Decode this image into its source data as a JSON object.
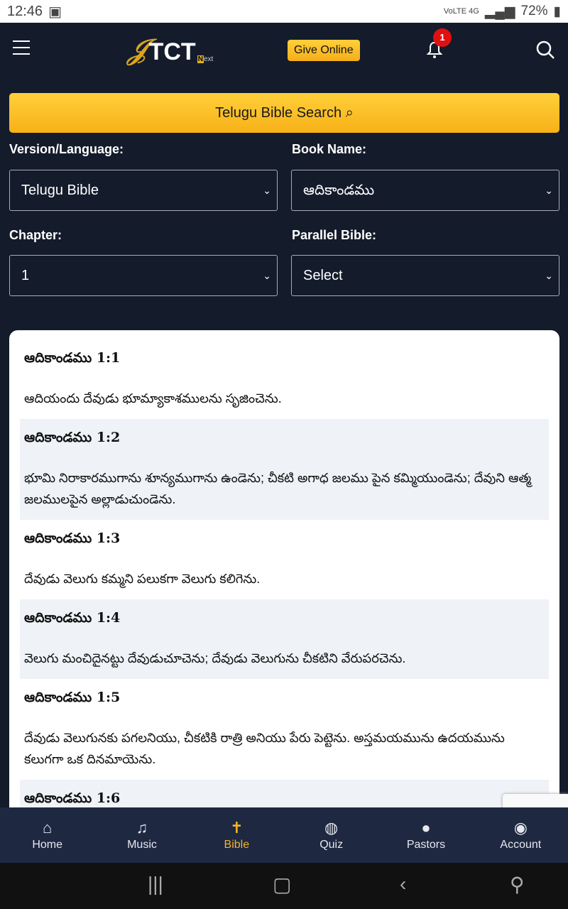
{
  "status_bar": {
    "time": "12:46",
    "network": "VoLTE 4G",
    "battery": "72%"
  },
  "header": {
    "logo_text": "TCT",
    "logo_suffix": "Next",
    "give_label": "Give Online",
    "notification_count": "1"
  },
  "search_button": "Telugu Bible Search",
  "form": {
    "version_label": "Version/Language:",
    "version_value": "Telugu Bible",
    "book_label": "Book Name:",
    "book_value": "ఆదికాండము",
    "chapter_label": "Chapter:",
    "chapter_value": "1",
    "parallel_label": "Parallel Bible:",
    "parallel_value": "Select"
  },
  "verses": [
    {
      "ref": "ఆదికాండము 1:1",
      "text": "ఆదియందు దేవుడు భూమ్యాకాశములను సృజించెను."
    },
    {
      "ref": "ఆదికాండము 1:2",
      "text": "భూమి నిరాకారముగాను శూన్యముగాను ఉండెను; చీకటి అగాధ జలము పైన కమ్మియుండెను; దేవుని ఆత్మ జలములపైన అల్లాడుచుండెను."
    },
    {
      "ref": "ఆదికాండము 1:3",
      "text": "దేవుడు వెలుగు కమ్మని పలుకగా వెలుగు కలిగెను."
    },
    {
      "ref": "ఆదికాండము 1:4",
      "text": "వెలుగు మంచిదైనట్టు దేవుడుచూచెను; దేవుడు వెలుగును చీకటిని వేరుపరచెను."
    },
    {
      "ref": "ఆదికాండము 1:5",
      "text": "దేవుడు వెలుగునకు పగలనియు, చీకటికి రాత్రి అనియు పేరు పెట్టెను. అస్తమయమును ఉదయమును కలుగగా ఒక దినమాయెను."
    },
    {
      "ref": "ఆదికాండము 1:6",
      "text": ""
    }
  ],
  "bottom_nav": [
    {
      "label": "Home",
      "icon": "home-icon"
    },
    {
      "label": "Music",
      "icon": "music-icon"
    },
    {
      "label": "Bible",
      "icon": "bible-icon",
      "active": true
    },
    {
      "label": "Quiz",
      "icon": "globe-icon"
    },
    {
      "label": "Pastors",
      "icon": "person-icon"
    },
    {
      "label": "Account",
      "icon": "account-icon"
    }
  ],
  "colors": {
    "accent": "#f3b629",
    "background": "#141b2b",
    "nav": "#1e2841"
  }
}
